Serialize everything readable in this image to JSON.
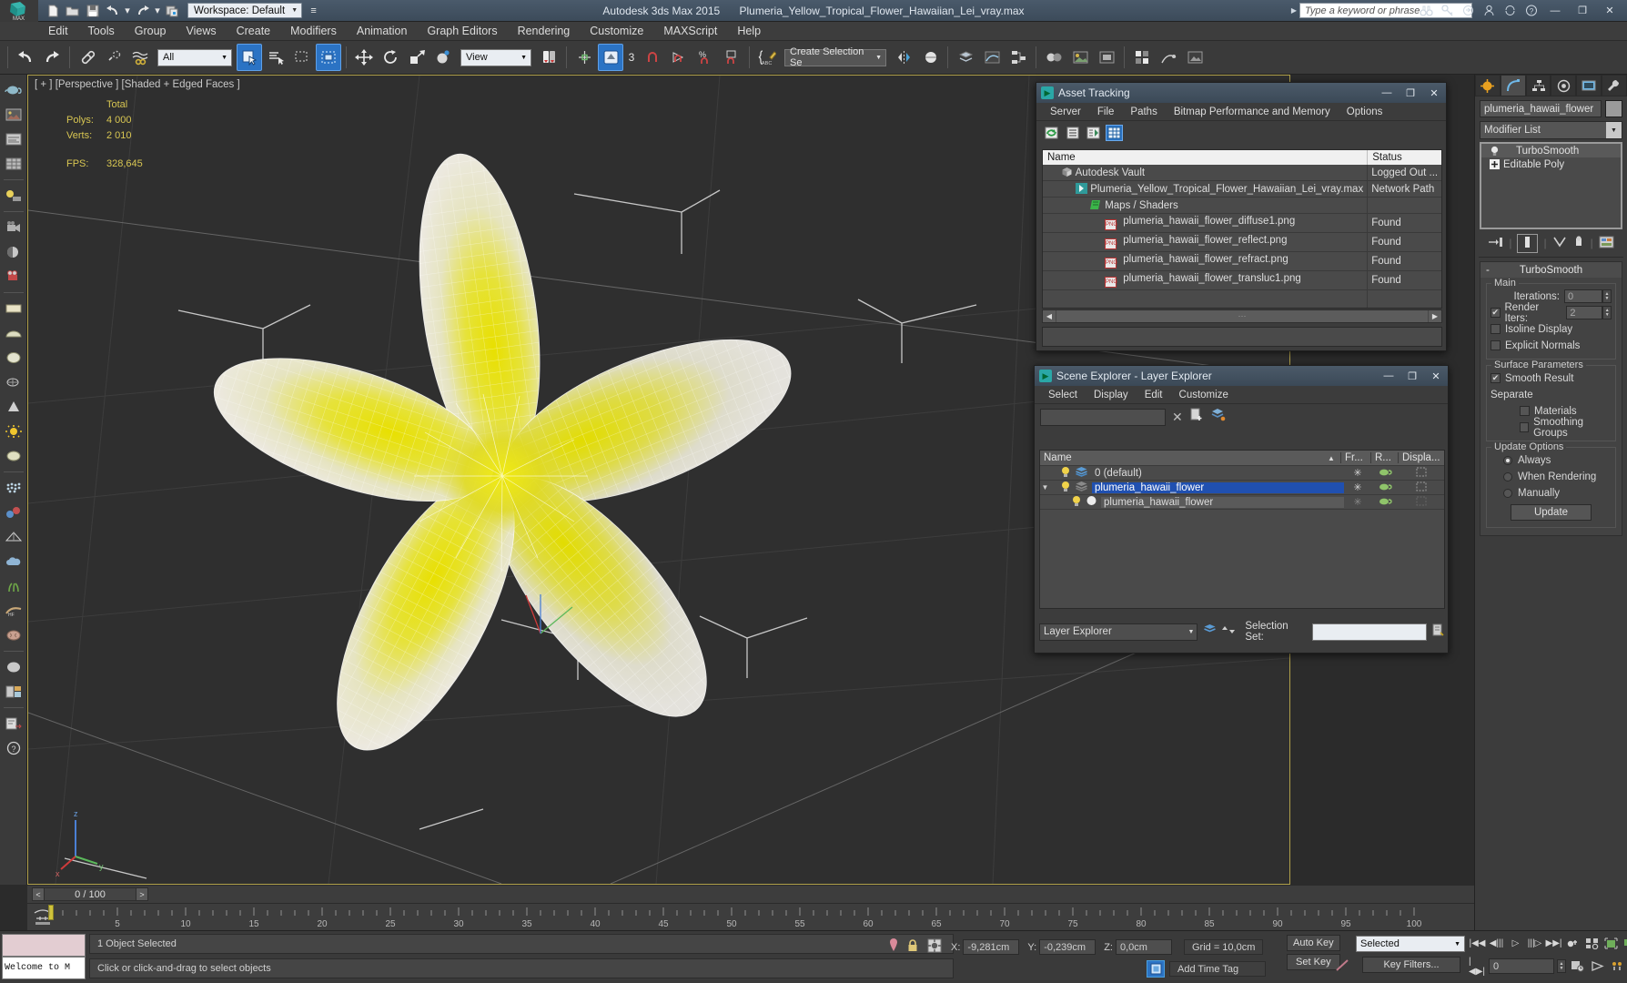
{
  "titlebar": {
    "app_title": "Autodesk 3ds Max  2015",
    "file_title": "Plumeria_Yellow_Tropical_Flower_Hawaiian_Lei_vray.max",
    "workspace": "Workspace: Default",
    "search_placeholder": "Type a keyword or phrase",
    "quick_access": [
      "new-icon",
      "open-icon",
      "save-icon",
      "undo-icon",
      "redo-icon",
      "set-project-icon"
    ],
    "window_buttons": [
      "minimize",
      "maximize",
      "close"
    ]
  },
  "menubar": {
    "items": [
      "Edit",
      "Tools",
      "Group",
      "Views",
      "Create",
      "Modifiers",
      "Animation",
      "Graph Editors",
      "Rendering",
      "Customize",
      "MAXScript",
      "Help"
    ]
  },
  "toolbar": {
    "selection_filter": "All",
    "reference_coord": "View",
    "selection_set": "Create Selection Se",
    "snap_angle": "3"
  },
  "viewport": {
    "label": "[ + ] [Perspective ] [Shaded + Edged Faces ]",
    "stats": {
      "header": "Total",
      "polys_label": "Polys:",
      "polys_value": "4 000",
      "verts_label": "Verts:",
      "verts_value": "2 010",
      "fps_label": "FPS:",
      "fps_value": "328,645"
    }
  },
  "asset_tracking": {
    "title": "Asset Tracking",
    "menu": [
      "Server",
      "File",
      "Paths",
      "Bitmap Performance and Memory",
      "Options"
    ],
    "toolbar_icons": [
      "refresh-icon",
      "list-view-icon",
      "path-view-icon",
      "table-view-icon"
    ],
    "columns": [
      "Name",
      "Status"
    ],
    "rows": [
      {
        "indent": 1,
        "icon": "vault-icon",
        "name": "Autodesk Vault",
        "status": "Logged Out ..."
      },
      {
        "indent": 2,
        "icon": "max-file-icon",
        "name": "Plumeria_Yellow_Tropical_Flower_Hawaiian_Lei_vray.max",
        "status": "Network Path"
      },
      {
        "indent": 3,
        "icon": "maps-icon",
        "name": "Maps / Shaders",
        "status": ""
      },
      {
        "indent": 4,
        "icon": "png-icon",
        "name": "plumeria_hawaii_flower_diffuse1.png",
        "status": "Found"
      },
      {
        "indent": 4,
        "icon": "png-icon",
        "name": "plumeria_hawaii_flower_reflect.png",
        "status": "Found"
      },
      {
        "indent": 4,
        "icon": "png-icon",
        "name": "plumeria_hawaii_flower_refract.png",
        "status": "Found"
      },
      {
        "indent": 4,
        "icon": "png-icon",
        "name": "plumeria_hawaii_flower_transluc1.png",
        "status": "Found"
      }
    ]
  },
  "scene_explorer": {
    "title": "Scene Explorer - Layer Explorer",
    "menu": [
      "Select",
      "Display",
      "Edit",
      "Customize"
    ],
    "filter_value": "",
    "columns": [
      "Name",
      "Fr...",
      "R...",
      "Displa..."
    ],
    "rows": [
      {
        "indent": 1,
        "name": "0 (default)",
        "selected": false,
        "sub": false
      },
      {
        "indent": 1,
        "name": "plumeria_hawaii_flower",
        "selected": true,
        "sub": false
      },
      {
        "indent": 2,
        "name": "plumeria_hawaii_flower",
        "selected": false,
        "sub": true
      }
    ],
    "footer_mode": "Layer Explorer",
    "selection_set_label": "Selection Set:",
    "selection_set_value": ""
  },
  "command_panel": {
    "tabs": [
      "create-tab",
      "modify-tab",
      "hierarchy-tab",
      "motion-tab",
      "display-tab",
      "utilities-tab"
    ],
    "active_tab_index": 1,
    "object_name": "plumeria_hawaii_flower",
    "modifier_list_label": "Modifier List",
    "modifier_stack": [
      {
        "name": "TurboSmooth",
        "icon": "light-bulb-icon",
        "highlighted": true
      },
      {
        "name": "Editable Poly",
        "icon": "plus-box-icon",
        "highlighted": false
      }
    ],
    "rollout_title": "TurboSmooth",
    "rollout_collapse": "-",
    "main_group": {
      "label": "Main",
      "iterations_label": "Iterations:",
      "iterations_value": "0",
      "render_iters_label": "Render Iters:",
      "render_iters_value": "2",
      "render_iters_checked": true,
      "isoline_label": "Isoline Display",
      "isoline_checked": false,
      "explicit_label": "Explicit Normals",
      "explicit_checked": false
    },
    "surface_group": {
      "label": "Surface Parameters",
      "smooth_result_label": "Smooth Result",
      "smooth_result_checked": true,
      "separate_label": "Separate",
      "materials_label": "Materials",
      "materials_checked": false,
      "smoothing_groups_label": "Smoothing Groups",
      "smoothing_groups_checked": false
    },
    "update_group": {
      "label": "Update Options",
      "options": [
        "Always",
        "When Rendering",
        "Manually"
      ],
      "selected_index": 0,
      "update_button": "Update"
    }
  },
  "timeline": {
    "current_frame": "0 / 100",
    "prev_arrow": "<",
    "next_arrow": ">",
    "ticks": [
      "5",
      "10",
      "15",
      "20",
      "25",
      "30",
      "35",
      "40",
      "45",
      "50",
      "55",
      "60",
      "65",
      "70",
      "75",
      "80",
      "85",
      "90",
      "95",
      "100"
    ]
  },
  "statusbar": {
    "mini_listener_text": "Welcome to M",
    "selection_status": "1 Object Selected",
    "prompt": "Click or click-and-drag to select objects",
    "x_label": "X:",
    "x_value": "-9,281cm",
    "y_label": "Y:",
    "y_value": "-0,239cm",
    "z_label": "Z:",
    "z_value": "0,0cm",
    "grid_label": "Grid = 10,0cm",
    "add_time_tag": "Add Time Tag",
    "auto_key": "Auto Key",
    "set_key": "Set Key",
    "key_mode": "Selected",
    "key_filters": "Key Filters...",
    "key_frame_value": "0"
  },
  "colors": {
    "accent_blue": "#2b73c4",
    "selection_blue": "#2050b0",
    "viewport_border": "#b0a04a",
    "stats_yellow": "#d8c652",
    "titlebar": "#45545f"
  }
}
